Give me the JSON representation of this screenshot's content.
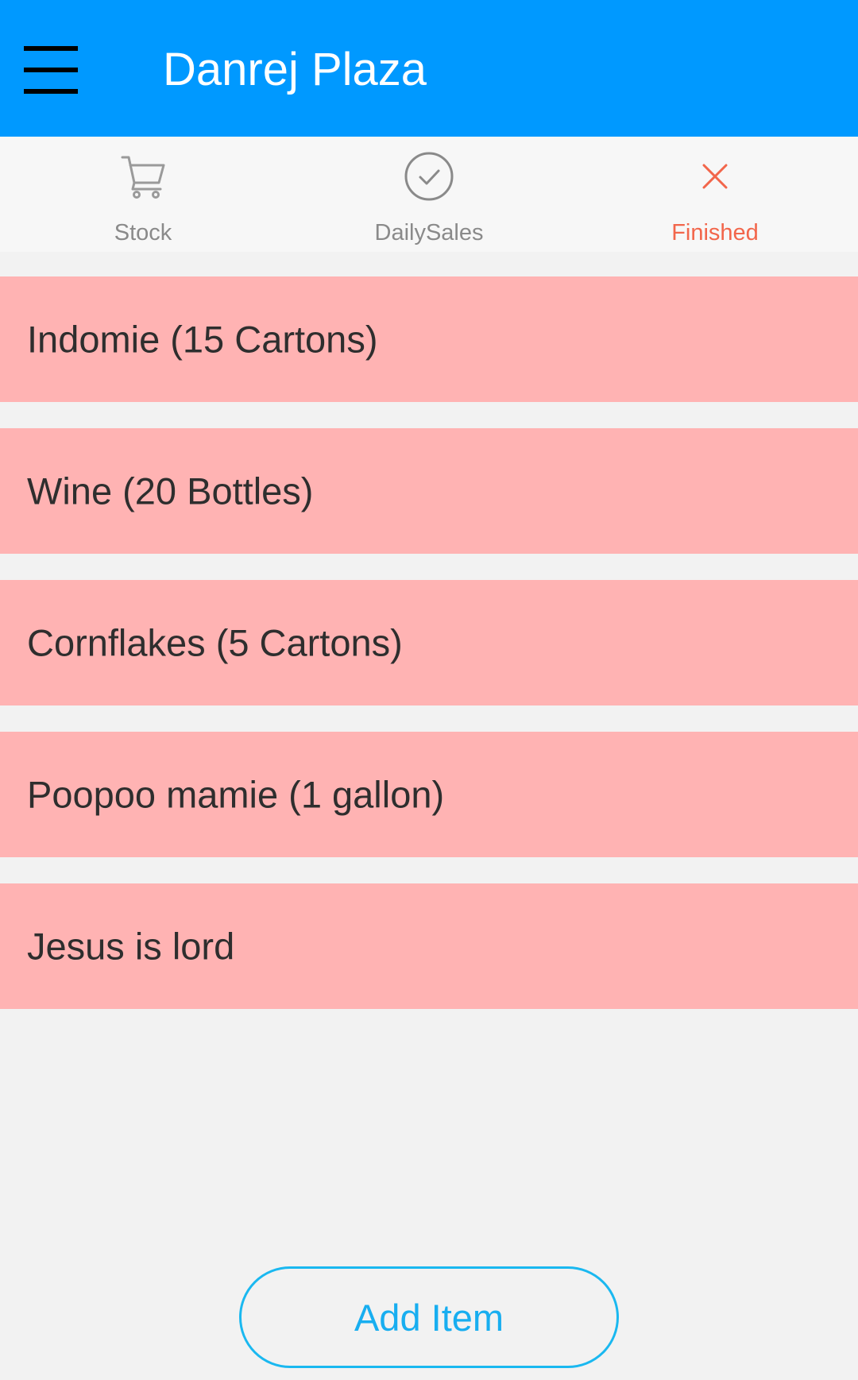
{
  "app_bar": {
    "title": "Danrej Plaza",
    "menu_icon": "hamburger-menu-icon",
    "background_color": "#0099ff"
  },
  "tabs": [
    {
      "label": "Stock",
      "icon": "cart-icon",
      "active": false
    },
    {
      "label": "DailySales",
      "icon": "check-circle-icon",
      "active": false
    },
    {
      "label": "Finished",
      "icon": "close-icon",
      "active": true
    }
  ],
  "items": [
    {
      "label": "Indomie (15 Cartons)"
    },
    {
      "label": "Wine (20 Bottles)"
    },
    {
      "label": "Cornflakes (5 Cartons)"
    },
    {
      "label": "Poopoo mamie (1 gallon)"
    },
    {
      "label": "Jesus is lord"
    }
  ],
  "add_button": {
    "label": "Add Item"
  },
  "colors": {
    "item_background": "#ffb3b3",
    "active_tab": "#f2664b",
    "inactive_tab": "#8a8a8a",
    "add_button": "#18aef0"
  }
}
